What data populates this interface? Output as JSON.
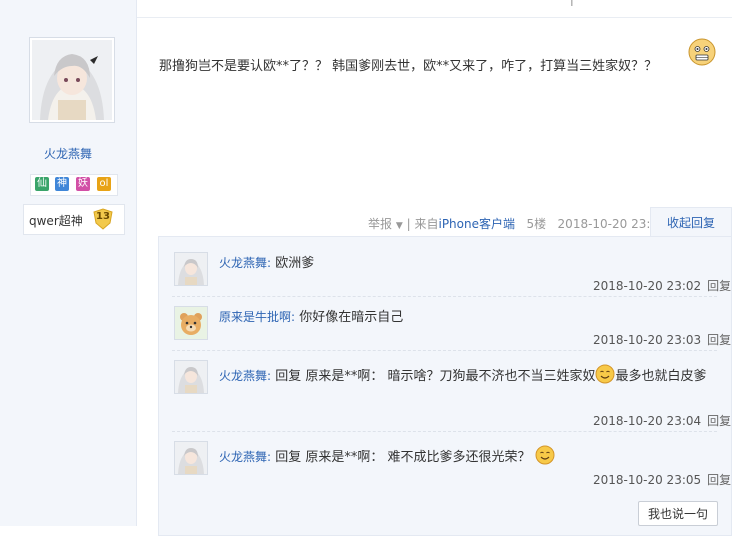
{
  "top_fragment": {
    "a": "",
    "b": "|",
    "c": ""
  },
  "author": {
    "name": "火龙燕舞",
    "badges": [
      {
        "label": "仙",
        "color": "#3aa46a"
      },
      {
        "label": "神",
        "color": "#3f86d8"
      },
      {
        "label": "妖",
        "color": "#d24fa6"
      },
      {
        "label": "ol",
        "color": "#e8a316"
      }
    ],
    "rank_name": "qwer超神",
    "rank_level": "13"
  },
  "post": {
    "text": "那撸狗岂不是要认欧**了？？ 韩国爹刚去世，欧**又来了，咋了，打算当三姓家奴？？",
    "emoji": "shocked-face"
  },
  "meta": {
    "report": "举报",
    "sep": "|",
    "source_prefix": "来自",
    "source": "iPhone客户端",
    "floor": "5楼",
    "time": "2018-10-20 23:02",
    "collapse": "收起回复"
  },
  "replies": [
    {
      "user": "火龙燕舞",
      "colon": ":",
      "text": "欧洲爹",
      "time": "2018-10-20 23:02",
      "reply": "回复",
      "avatar": "anime-girl"
    },
    {
      "user": "原来是牛批啊",
      "colon": ":",
      "text": "你好像在暗示自己",
      "time": "2018-10-20 23:03",
      "reply": "回复",
      "avatar": "bear"
    },
    {
      "user": "火龙燕舞",
      "colon": ":",
      "text_a": "回复 原来是**啊： 暗示啥？刀狗最不济也不当三姓家奴",
      "text_b": "最多也就白皮爹",
      "time": "2018-10-20 23:04",
      "reply": "回复",
      "avatar": "anime-girl"
    },
    {
      "user": "火龙燕舞",
      "colon": ":",
      "text": "回复 原来是**啊： 难不成比爹多还很光荣？",
      "time": "2018-10-20 23:05",
      "reply": "回复",
      "avatar": "anime-girl"
    }
  ],
  "say_button": "我也说一句"
}
